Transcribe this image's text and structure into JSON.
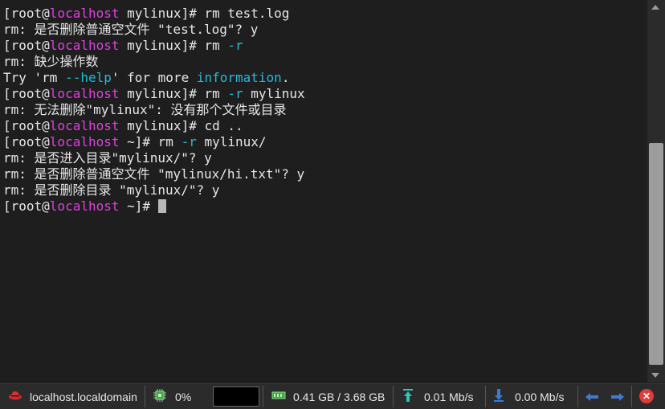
{
  "terminal": {
    "lines": [
      [
        {
          "t": "[root@"
        },
        {
          "t": "localhost",
          "c": "m"
        },
        {
          "t": " mylinux]# rm test.log"
        }
      ],
      [
        {
          "t": "rm: 是否删除普通空文件 \"test.log\"? y"
        }
      ],
      [
        {
          "t": "[root@"
        },
        {
          "t": "localhost",
          "c": "m"
        },
        {
          "t": " mylinux]# rm "
        },
        {
          "t": "-r",
          "c": "c"
        }
      ],
      [
        {
          "t": "rm: 缺少操作数"
        }
      ],
      [
        {
          "t": "Try '"
        },
        {
          "t": "rm ",
          "c": "n"
        },
        {
          "t": "--help",
          "c": "c"
        },
        {
          "t": "' for more "
        },
        {
          "t": "information",
          "c": "c"
        },
        {
          "t": "."
        }
      ],
      [
        {
          "t": "[root@"
        },
        {
          "t": "localhost",
          "c": "m"
        },
        {
          "t": " mylinux]# rm "
        },
        {
          "t": "-r",
          "c": "c"
        },
        {
          "t": " mylinux"
        }
      ],
      [
        {
          "t": "rm: 无法删除\"mylinux\": 没有那个文件或目录"
        }
      ],
      [
        {
          "t": "[root@"
        },
        {
          "t": "localhost",
          "c": "m"
        },
        {
          "t": " mylinux]# cd .."
        }
      ],
      [
        {
          "t": "[root@"
        },
        {
          "t": "localhost",
          "c": "m"
        },
        {
          "t": " ~]# rm "
        },
        {
          "t": "-r",
          "c": "c"
        },
        {
          "t": " mylinux/"
        }
      ],
      [
        {
          "t": "rm: 是否进入目录\"mylinux/\"? y"
        }
      ],
      [
        {
          "t": "rm: 是否删除普通空文件 \"mylinux/hi.txt\"? y"
        }
      ],
      [
        {
          "t": "rm: 是否删除目录 \"mylinux/\"? y"
        }
      ],
      [
        {
          "t": "[root@"
        },
        {
          "t": "localhost",
          "c": "m"
        },
        {
          "t": " ~]# "
        }
      ]
    ],
    "colors": {
      "text": "#e6e6e6",
      "host": "#e040e0",
      "option": "#29b8db",
      "background": "#1e1e1e"
    }
  },
  "statusbar": {
    "host": "localhost.localdomain",
    "cpu": "0%",
    "memory": "0.41 GB / 3.68 GB",
    "upload": "0.01 Mb/s",
    "download": "0.00 Mb/s",
    "icons": {
      "host": "redhat-icon",
      "cpu": "cpu-chip-icon",
      "memory": "memory-icon",
      "upload": "upload-arrow-icon",
      "download": "download-arrow-icon",
      "prev": "arrow-left-icon",
      "next": "arrow-right-icon",
      "close": "close-icon"
    }
  }
}
